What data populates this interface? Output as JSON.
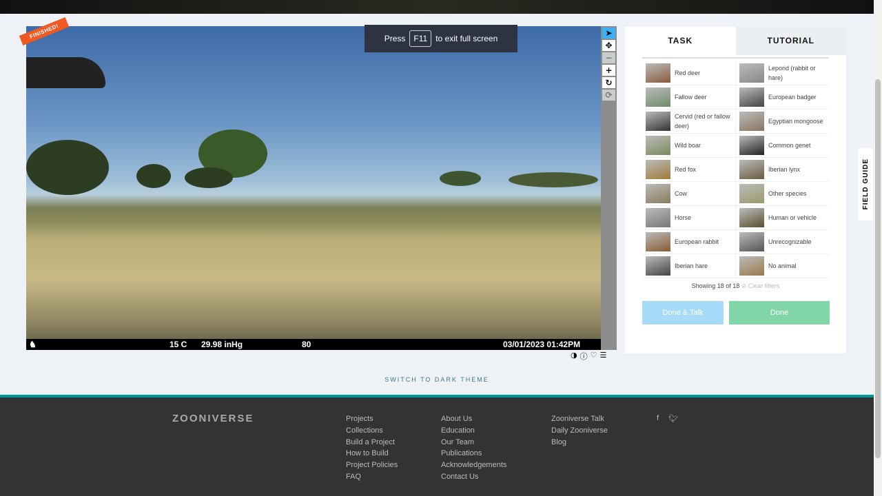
{
  "banner": {
    "press": "Press",
    "key": "F11",
    "rest": "to exit full screen"
  },
  "ribbon": "FINISHED!",
  "stamp": {
    "temp": "15 C",
    "pressure": "29.98 inHg",
    "number": "80",
    "datetime": "03/01/2023  01:42PM"
  },
  "tabs": {
    "task": "TASK",
    "tutorial": "TUTORIAL"
  },
  "choices": [
    {
      "label": "Red deer",
      "color": "#8a5a3a"
    },
    {
      "label": "Leporid (rabbit or hare)",
      "color": "#888"
    },
    {
      "label": "Fallow deer",
      "color": "#6f8a6a"
    },
    {
      "label": "European badger",
      "color": "#444"
    },
    {
      "label": "Cervid (red or fallow deer)",
      "color": "#333"
    },
    {
      "label": "Egyptian mongoose",
      "color": "#8a7560"
    },
    {
      "label": "Wild boar",
      "color": "#7a8a5a"
    },
    {
      "label": "Common genet",
      "color": "#222"
    },
    {
      "label": "Red fox",
      "color": "#a07a3a"
    },
    {
      "label": "Iberian lynx",
      "color": "#6a5a40"
    },
    {
      "label": "Cow",
      "color": "#8a7a5a"
    },
    {
      "label": "Other species",
      "color": "#9a9a6a"
    },
    {
      "label": "Horse",
      "color": "#777"
    },
    {
      "label": "Human or vehicle",
      "color": "#5a5030"
    },
    {
      "label": "European rabbit",
      "color": "#8a5a30"
    },
    {
      "label": "Unrecognizable",
      "color": "#555"
    },
    {
      "label": "Iberian hare",
      "color": "#444"
    },
    {
      "label": "No animal",
      "color": "#9a7a4a"
    }
  ],
  "showing": "Showing 18 of 18",
  "clear_filters": "⊘ Clear filters",
  "buttons": {
    "done_talk": "Done & Talk",
    "done": "Done",
    "done_talk_color": "#a6dcf7",
    "done_color": "#80d6a8"
  },
  "field_guide": "FIELD GUIDE",
  "switch_theme": "SWITCH TO DARK THEME",
  "footer": {
    "logo": "ZOONIVERSE",
    "col1": [
      "Projects",
      "Collections",
      "Build a Project",
      "How to Build",
      "Project Policies",
      "FAQ"
    ],
    "col2": [
      "About Us",
      "Education",
      "Our Team",
      "Publications",
      "Acknowledgements",
      "Contact Us"
    ],
    "col3": [
      "Zooniverse Talk",
      "Daily Zooniverse",
      "Blog"
    ]
  }
}
